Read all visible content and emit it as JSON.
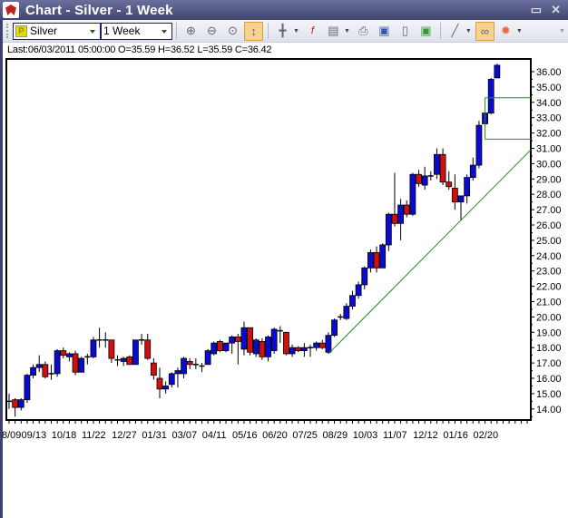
{
  "window": {
    "title": "Chart - Silver - 1 Week",
    "minimize": "▭",
    "close": "✕"
  },
  "toolbar": {
    "symbol": "Silver",
    "symbol_icon": "P",
    "interval": "1 Week",
    "buttons": [
      "zoom-in-icon",
      "zoom-out-icon",
      "zoom-fit-icon",
      "autoscale-icon",
      "crosshair-icon",
      "function-icon",
      "template-icon",
      "print-icon",
      "save-icon",
      "document-icon",
      "save-image-icon",
      "line-tool-icon",
      "link-icon",
      "bug-icon"
    ]
  },
  "info": "Last:06/03/2011 05:00:00 O=35.59 H=36.52 L=35.59 C=36.42",
  "colors": {
    "up": "#0a0ad0",
    "down": "#d01010",
    "trend": "#228B22"
  },
  "chart_data": {
    "type": "candlestick",
    "title": "Silver - 1 Week",
    "ylim": [
      13.4,
      36.8
    ],
    "yticks": [
      "14.00",
      "15.00",
      "16.00",
      "17.00",
      "18.00",
      "19.00",
      "20.00",
      "21.00",
      "22.00",
      "23.00",
      "24.00",
      "25.00",
      "26.00",
      "27.00",
      "28.00",
      "29.00",
      "30.00",
      "31.00",
      "32.00",
      "33.00",
      "34.00",
      "35.00",
      "36.00"
    ],
    "xlabels": [
      "8/09",
      "09/13",
      "10/18",
      "11/22",
      "12/27",
      "01/31",
      "03/07",
      "04/11",
      "05/16",
      "06/20",
      "07/25",
      "08/29",
      "10/03",
      "11/07",
      "12/12",
      "01/16",
      "02/20"
    ],
    "ohlc": [
      [
        14.5,
        15.0,
        14.0,
        14.5
      ],
      [
        14.6,
        14.7,
        13.5,
        14.1
      ],
      [
        14.1,
        14.7,
        13.9,
        14.6
      ],
      [
        14.6,
        16.3,
        14.4,
        16.2
      ],
      [
        16.2,
        16.9,
        16.0,
        16.7
      ],
      [
        16.7,
        17.5,
        16.4,
        16.9
      ],
      [
        16.9,
        17.1,
        16.0,
        16.1
      ],
      [
        16.3,
        16.9,
        15.9,
        16.3
      ],
      [
        16.3,
        17.9,
        16.1,
        17.8
      ],
      [
        17.8,
        18.0,
        17.3,
        17.5
      ],
      [
        17.4,
        17.7,
        17.1,
        17.6
      ],
      [
        17.6,
        17.8,
        16.2,
        16.4
      ],
      [
        16.4,
        17.4,
        16.4,
        17.3
      ],
      [
        17.4,
        17.6,
        16.9,
        17.4
      ],
      [
        17.4,
        18.7,
        17.3,
        18.5
      ],
      [
        18.5,
        19.3,
        18.0,
        18.5
      ],
      [
        18.5,
        19.0,
        18.0,
        18.5
      ],
      [
        18.5,
        18.5,
        17.0,
        17.3
      ],
      [
        17.2,
        17.5,
        16.8,
        17.2
      ],
      [
        17.1,
        17.4,
        16.8,
        17.3
      ],
      [
        17.4,
        17.5,
        16.9,
        16.9
      ],
      [
        16.9,
        18.5,
        16.9,
        18.5
      ],
      [
        18.5,
        18.9,
        18.2,
        18.5
      ],
      [
        18.5,
        18.9,
        17.2,
        17.3
      ],
      [
        17.0,
        17.3,
        15.9,
        16.2
      ],
      [
        16.0,
        16.7,
        14.7,
        15.3
      ],
      [
        15.3,
        15.8,
        15.0,
        15.5
      ],
      [
        15.6,
        16.4,
        15.4,
        16.3
      ],
      [
        16.3,
        16.7,
        15.4,
        16.5
      ],
      [
        16.3,
        17.4,
        16.0,
        17.3
      ],
      [
        17.1,
        17.3,
        16.6,
        16.9
      ],
      [
        16.9,
        17.3,
        16.6,
        16.9
      ],
      [
        16.8,
        17.0,
        16.4,
        16.8
      ],
      [
        16.9,
        17.9,
        16.9,
        17.8
      ],
      [
        17.6,
        18.4,
        17.5,
        18.3
      ],
      [
        18.4,
        18.5,
        17.7,
        17.8
      ],
      [
        17.8,
        18.3,
        17.7,
        18.3
      ],
      [
        18.3,
        18.8,
        17.6,
        18.7
      ],
      [
        18.7,
        18.9,
        16.9,
        18.4
      ],
      [
        17.9,
        19.7,
        17.5,
        19.3
      ],
      [
        19.3,
        19.3,
        17.5,
        17.7
      ],
      [
        17.6,
        18.6,
        17.4,
        18.5
      ],
      [
        18.4,
        18.6,
        17.2,
        17.4
      ],
      [
        17.4,
        18.8,
        17.1,
        18.7
      ],
      [
        17.8,
        19.3,
        17.6,
        19.2
      ],
      [
        19.1,
        19.4,
        18.3,
        19.1
      ],
      [
        19.0,
        19.0,
        17.5,
        17.6
      ],
      [
        17.6,
        18.2,
        17.4,
        18.0
      ],
      [
        18.0,
        18.1,
        17.7,
        17.8
      ],
      [
        17.8,
        18.3,
        17.4,
        18.0
      ],
      [
        18.0,
        18.2,
        17.4,
        18.0
      ],
      [
        18.0,
        18.4,
        17.8,
        18.3
      ],
      [
        18.3,
        18.5,
        17.9,
        18.0
      ],
      [
        17.7,
        19.0,
        17.6,
        18.8
      ],
      [
        18.8,
        19.9,
        18.7,
        19.8
      ],
      [
        20.0,
        20.2,
        19.8,
        20.0
      ],
      [
        19.9,
        20.9,
        19.8,
        20.7
      ],
      [
        20.7,
        21.7,
        20.5,
        21.4
      ],
      [
        21.4,
        22.3,
        21.2,
        22.1
      ],
      [
        22.1,
        23.3,
        21.8,
        23.2
      ],
      [
        23.2,
        24.4,
        22.9,
        24.2
      ],
      [
        24.2,
        24.6,
        22.9,
        23.2
      ],
      [
        23.2,
        24.8,
        23.2,
        24.7
      ],
      [
        24.7,
        26.8,
        24.3,
        26.7
      ],
      [
        26.7,
        29.4,
        25.9,
        26.1
      ],
      [
        26.1,
        27.7,
        25.0,
        27.3
      ],
      [
        27.3,
        27.6,
        26.5,
        26.7
      ],
      [
        26.7,
        29.4,
        26.6,
        29.3
      ],
      [
        29.3,
        29.6,
        28.5,
        28.7
      ],
      [
        28.6,
        29.8,
        28.3,
        29.2
      ],
      [
        29.2,
        29.5,
        28.9,
        29.2
      ],
      [
        29.3,
        31.0,
        29.0,
        30.6
      ],
      [
        30.6,
        31.0,
        28.6,
        28.8
      ],
      [
        28.8,
        29.5,
        28.3,
        28.5
      ],
      [
        28.4,
        29.3,
        27.0,
        27.5
      ],
      [
        27.5,
        27.9,
        26.3,
        27.9
      ],
      [
        27.9,
        29.3,
        27.4,
        29.1
      ],
      [
        29.1,
        30.4,
        28.9,
        29.9
      ],
      [
        29.9,
        32.8,
        29.7,
        32.5
      ],
      [
        32.6,
        33.4,
        32.4,
        33.3
      ],
      [
        33.3,
        35.6,
        33.2,
        35.5
      ],
      [
        35.59,
        36.52,
        35.59,
        36.42
      ]
    ],
    "trendline": {
      "from": [
        53,
        17.6
      ],
      "to": [
        86.6,
        30.9
      ]
    },
    "channel": {
      "start": 79,
      "upper": 34.3,
      "lower": 31.6
    }
  }
}
